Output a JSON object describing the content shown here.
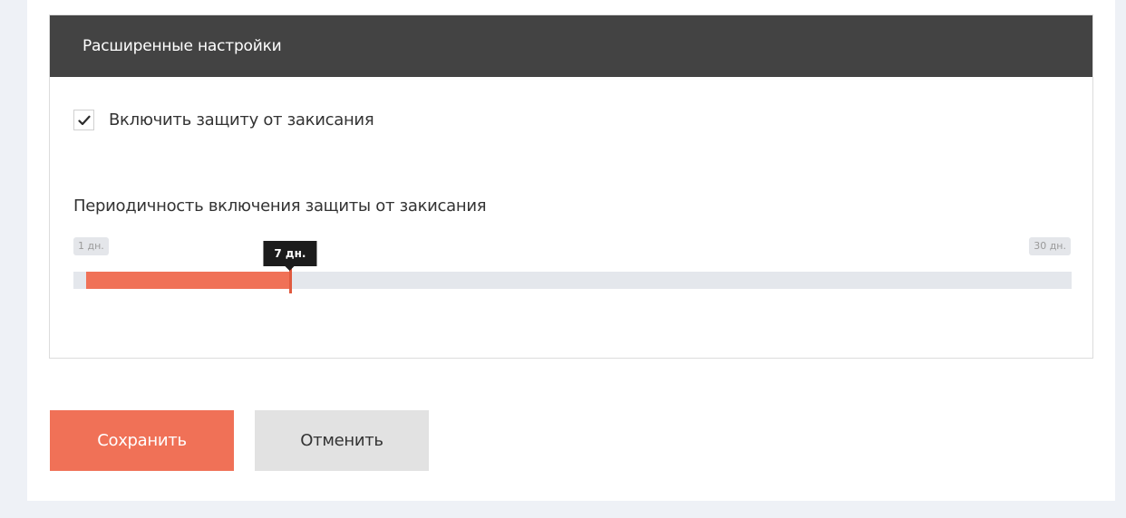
{
  "panel": {
    "title": "Расширенные настройки"
  },
  "hang_protection": {
    "label": "Включить защиту от закисания",
    "checked": true
  },
  "slider": {
    "title": "Периодичность включения защиты от закисания",
    "min_label": "1 дн.",
    "max_label": "30 дн.",
    "value_label": "7 дн.",
    "min": 1,
    "max": 30,
    "value": 7,
    "fill_color": "#f07157",
    "track_color": "#e4e7ec"
  },
  "actions": {
    "save_label": "Сохранить",
    "cancel_label": "Отменить",
    "save_color": "#f07157",
    "cancel_color": "#e2e2e2"
  },
  "icons": {
    "checkbox": "checkmark-icon"
  }
}
